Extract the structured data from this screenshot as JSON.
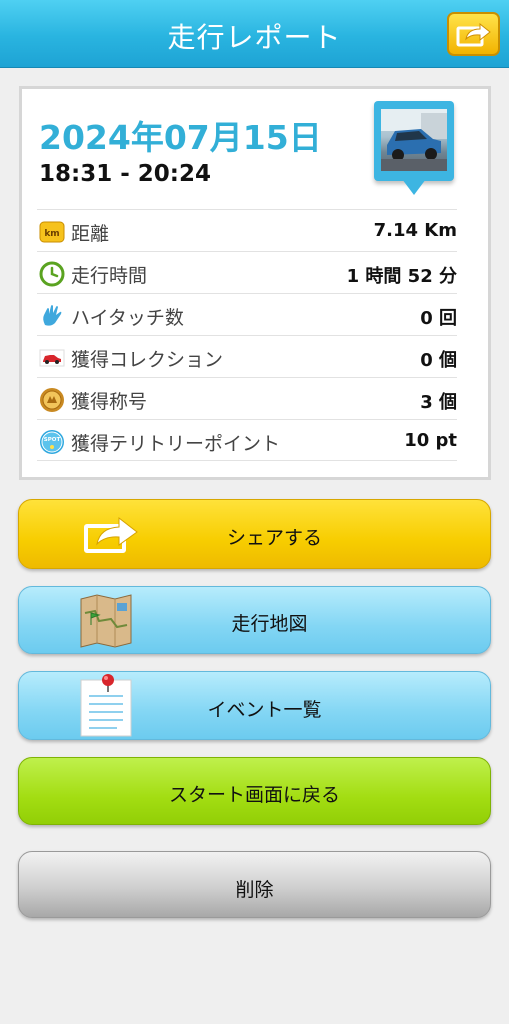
{
  "header": {
    "title": "走行レポート",
    "share_icon": "share-arrow-icon"
  },
  "report": {
    "date": "2024年07月15日",
    "time_range": "18:31 - 20:24",
    "car_photo_icon": "car-photo-pin-icon",
    "stats": [
      {
        "icon": "km-icon",
        "label": "距離",
        "value": "7.14 Km"
      },
      {
        "icon": "clock-icon",
        "label": "走行時間",
        "value": "1 時間 52 分"
      },
      {
        "icon": "hand-icon",
        "label": "ハイタッチ数",
        "value": "0 回"
      },
      {
        "icon": "car-icon",
        "label": "獲得コレクション",
        "value": "0 個"
      },
      {
        "icon": "medal-icon",
        "label": "獲得称号",
        "value": "3 個"
      },
      {
        "icon": "spot-icon",
        "label": "獲得テリトリーポイント",
        "value": "10 pt"
      }
    ],
    "spot_badge_text": "SPOT",
    "km_badge_text": "km"
  },
  "buttons": {
    "share": "シェアする",
    "map": "走行地図",
    "events": "イベント一覧",
    "back_to_start": "スタート画面に戻る",
    "delete": "削除"
  },
  "colors": {
    "header": "#29b4e0",
    "date": "#32afd7",
    "share_button": "#f7cd00",
    "blue_button": "#83d6f4",
    "green_button": "#a3dd12",
    "gray_button": "#cfcfcf"
  }
}
